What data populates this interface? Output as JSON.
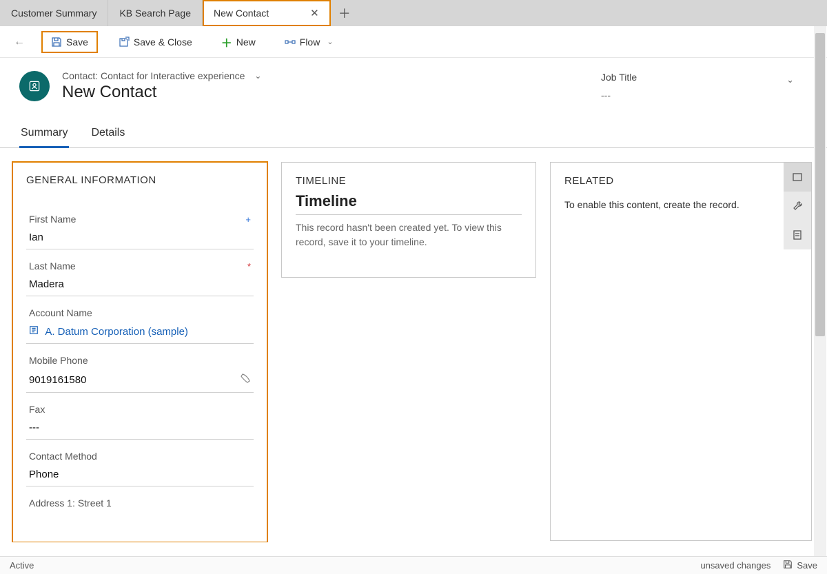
{
  "tabs": [
    {
      "label": "Customer Summary"
    },
    {
      "label": "KB Search Page"
    },
    {
      "label": "New Contact",
      "active": true
    }
  ],
  "commands": {
    "save": "Save",
    "save_close": "Save & Close",
    "new": "New",
    "flow": "Flow"
  },
  "header": {
    "form_selector": "Contact: Contact for Interactive experience",
    "title": "New Contact",
    "job_title_label": "Job Title",
    "job_title_value": "---"
  },
  "form_tabs": [
    {
      "label": "Summary",
      "active": true
    },
    {
      "label": "Details"
    }
  ],
  "general": {
    "section_title": "GENERAL INFORMATION",
    "first_name": {
      "label": "First Name",
      "value": "Ian",
      "recommended": "+"
    },
    "last_name": {
      "label": "Last Name",
      "value": "Madera",
      "required": "*"
    },
    "account_name": {
      "label": "Account Name",
      "value": "A. Datum Corporation (sample)"
    },
    "mobile": {
      "label": "Mobile Phone",
      "value": "9019161580"
    },
    "fax": {
      "label": "Fax",
      "value": "---"
    },
    "contact_method": {
      "label": "Contact Method",
      "value": "Phone"
    },
    "address1": {
      "label": "Address 1: Street 1"
    }
  },
  "timeline": {
    "section_title": "TIMELINE",
    "heading": "Timeline",
    "message": "This record hasn't been created yet.  To view this record, save it to your timeline."
  },
  "related": {
    "section_title": "RELATED",
    "message": "To enable this content, create the record."
  },
  "status": {
    "left": "Active",
    "unsaved": "unsaved changes",
    "save": "Save"
  }
}
